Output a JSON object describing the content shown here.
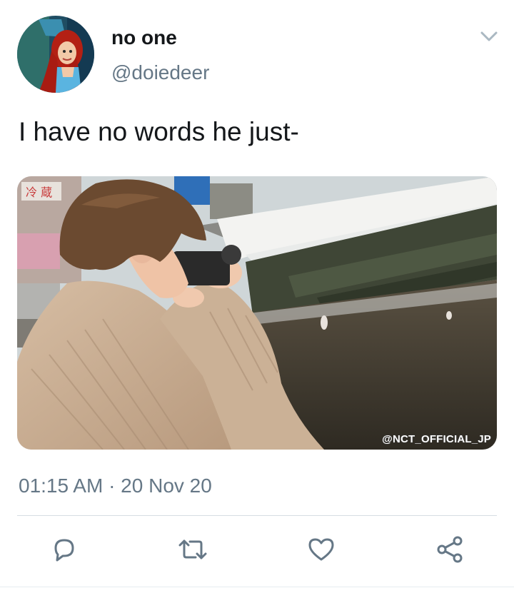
{
  "tweet": {
    "display_name": "no one",
    "handle": "@doiedeer",
    "text": "I have no words he just-",
    "media_watermark": "@NCT_OFFICIAL_JP",
    "media_sign_text": "冷 蔵",
    "timestamp": "01:15 AM · 20 Nov 20"
  },
  "icons": {
    "menu": "chevron-down-icon",
    "reply": "reply-icon",
    "retweet": "retweet-icon",
    "like": "heart-icon",
    "share": "share-icon"
  },
  "colors": {
    "text_primary": "#14171a",
    "text_secondary": "#657786",
    "icon_gray": "#657786",
    "divider": "#d6dde3"
  }
}
